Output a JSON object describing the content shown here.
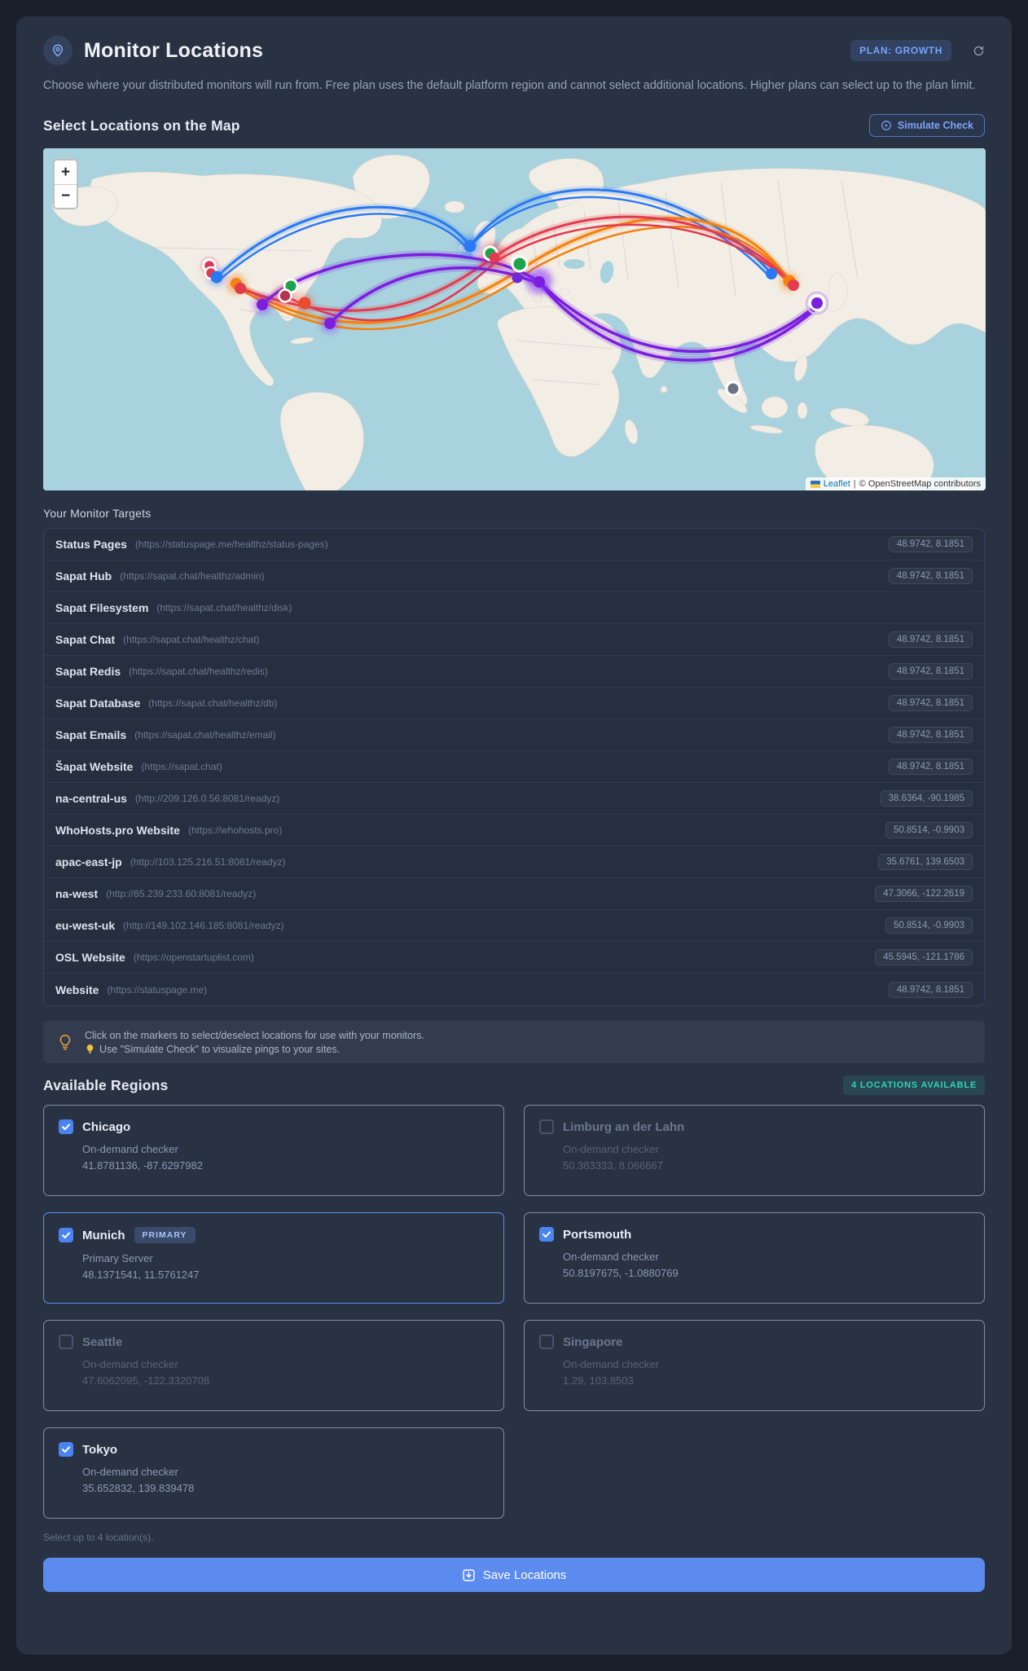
{
  "header": {
    "title": "Monitor Locations",
    "plan_badge": "PLAN: GROWTH",
    "description": "Choose where your distributed monitors will run from. Free plan uses the default platform region and cannot select additional locations. Higher plans can select up to the plan limit."
  },
  "map_section": {
    "heading": "Select Locations on the Map",
    "simulate_button": "Simulate Check",
    "zoom_in": "+",
    "zoom_out": "−",
    "attribution": {
      "leaflet": "Leaflet",
      "separator": "|",
      "osm": "© OpenStreetMap contributors"
    },
    "markers": [
      {
        "name": "seattle-red-1",
        "color": "#d8365a"
      },
      {
        "name": "seattle-red-2",
        "color": "#e23b4f"
      },
      {
        "name": "seattle-blue",
        "color": "#2979f3"
      },
      {
        "name": "us-central-orange",
        "color": "#f5820d"
      },
      {
        "name": "us-central-red",
        "color": "#e23b4f"
      },
      {
        "name": "chicago-green",
        "color": "#1ea34d"
      },
      {
        "name": "us-darkred",
        "color": "#b5344e"
      },
      {
        "name": "us-southeast-red",
        "color": "#ea4a2d"
      },
      {
        "name": "us-south-purple-1",
        "color": "#7a1fe0"
      },
      {
        "name": "us-south-purple-2",
        "color": "#7a1fe0"
      },
      {
        "name": "uk-blue",
        "color": "#2979f3"
      },
      {
        "name": "uk-green",
        "color": "#1ea34d"
      },
      {
        "name": "uk-red",
        "color": "#e23b4f"
      },
      {
        "name": "munich-green",
        "color": "#1ea34d"
      },
      {
        "name": "italy-purple-1",
        "color": "#6d28d9"
      },
      {
        "name": "italy-purple-2",
        "color": "#7a1fe0"
      },
      {
        "name": "china-blue",
        "color": "#2979f3"
      },
      {
        "name": "korea-orange",
        "color": "#f5820d"
      },
      {
        "name": "korea-red",
        "color": "#e23b4f"
      },
      {
        "name": "tokyo-purple",
        "color": "#7a1fe0"
      },
      {
        "name": "singapore-gray",
        "color": "#6b7280"
      }
    ]
  },
  "targets": {
    "heading": "Your Monitor Targets",
    "rows": [
      {
        "name": "Status Pages",
        "url": "(https://statuspage.me/healthz/status-pages)",
        "coords": "48.9742, 8.1851"
      },
      {
        "name": "Sapat Hub",
        "url": "(https://sapat.chat/healthz/admin)",
        "coords": "48.9742, 8.1851"
      },
      {
        "name": "Sapat Filesystem",
        "url": "(https://sapat.chat/healthz/disk)",
        "coords": ""
      },
      {
        "name": "Sapat Chat",
        "url": "(https://sapat.chat/healthz/chat)",
        "coords": "48.9742, 8.1851"
      },
      {
        "name": "Sapat Redis",
        "url": "(https://sapat.chat/healthz/redis)",
        "coords": "48.9742, 8.1851"
      },
      {
        "name": "Sapat Database",
        "url": "(https://sapat.chat/healthz/db)",
        "coords": "48.9742, 8.1851"
      },
      {
        "name": "Sapat Emails",
        "url": "(https://sapat.chat/healthz/email)",
        "coords": "48.9742, 8.1851"
      },
      {
        "name": "Šapat Website",
        "url": "(https://sapat.chat)",
        "coords": "48.9742, 8.1851"
      },
      {
        "name": "na-central-us",
        "url": "(http://209.126.0.56:8081/readyz)",
        "coords": "38.6364, -90.1985"
      },
      {
        "name": "WhoHosts.pro Website",
        "url": "(https://whohosts.pro)",
        "coords": "50.8514, -0.9903"
      },
      {
        "name": "apac-east-jp",
        "url": "(http://103.125.216.51:8081/readyz)",
        "coords": "35.6761, 139.6503"
      },
      {
        "name": "na-west",
        "url": "(http://85.239.233.60:8081/readyz)",
        "coords": "47.3066, -122.2619"
      },
      {
        "name": "eu-west-uk",
        "url": "(http://149.102.146.185:8081/readyz)",
        "coords": "50.8514, -0.9903"
      },
      {
        "name": "OSL Website",
        "url": "(https://openstartuplist.com)",
        "coords": "45.5945, -121.1786"
      },
      {
        "name": "Website",
        "url": "(https://statuspage.me)",
        "coords": "48.9742, 8.1851"
      }
    ]
  },
  "tip": {
    "line1": "Click on the markers to select/deselect locations for use with your monitors.",
    "line2": "Use \"Simulate Check\" to visualize pings to your sites."
  },
  "regions": {
    "heading": "Available Regions",
    "availability_badge": "4 LOCATIONS AVAILABLE",
    "cards": [
      {
        "name": "Chicago",
        "subtitle": "On-demand checker",
        "coords": "41.8781136, -87.6297982",
        "checked": true
      },
      {
        "name": "Limburg an der Lahn",
        "subtitle": "On-demand checker",
        "coords": "50.383333, 8.066667",
        "checked": false
      },
      {
        "name": "Munich",
        "badge": "PRIMARY",
        "subtitle": "Primary Server",
        "coords": "48.1371541, 11.5761247",
        "checked": true
      },
      {
        "name": "Portsmouth",
        "subtitle": "On-demand checker",
        "coords": "50.8197675, -1.0880769",
        "checked": true
      },
      {
        "name": "Seattle",
        "subtitle": "On-demand checker",
        "coords": "47.6062095, -122.3320708",
        "checked": false
      },
      {
        "name": "Singapore",
        "subtitle": "On-demand checker",
        "coords": "1.29, 103.8503",
        "checked": false
      },
      {
        "name": "Tokyo",
        "subtitle": "On-demand checker",
        "coords": "35.652832, 139.839478",
        "checked": true
      }
    ],
    "footnote": "Select up to 4 location(s)."
  },
  "save_button": "Save Locations",
  "colors": {
    "accent_blue": "#5b8bee",
    "teal_badge": "#2dd4bf",
    "map_water": "#a9d2df",
    "map_land": "#f2eee5",
    "arc_blue": "#2979f3",
    "arc_orange": "#f5820d",
    "arc_red": "#e23b4f",
    "arc_purple": "#7a1fe0"
  }
}
